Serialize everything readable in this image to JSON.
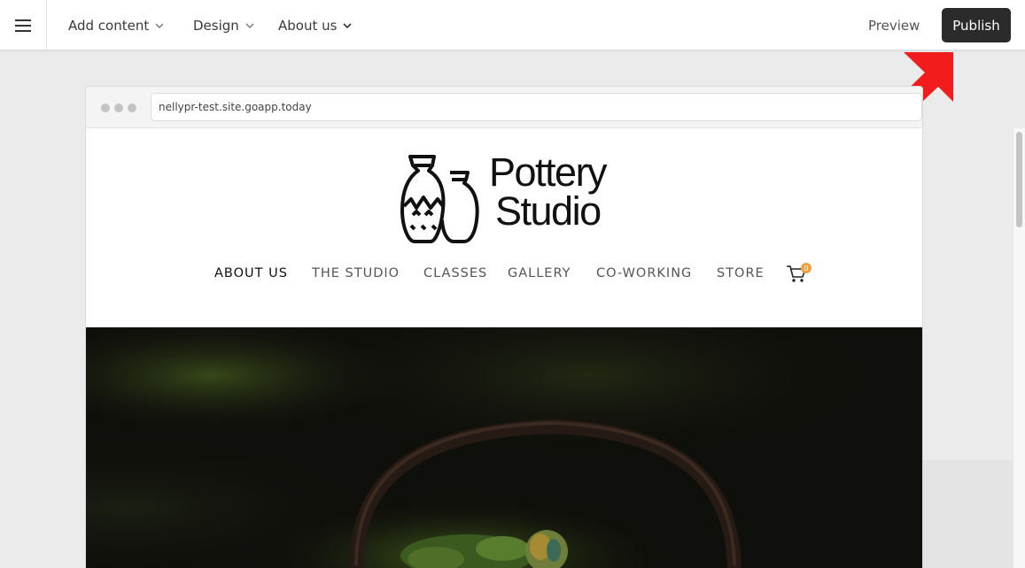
{
  "toolbar": {
    "menu_icon": "hamburger-menu-icon",
    "add_content": "Add content",
    "design": "Design",
    "about_us": "About us",
    "preview": "Preview",
    "publish": "Publish",
    "publish_bg": "#2b2b2b"
  },
  "annotation": {
    "arrow_color": "#f21c1c"
  },
  "browser": {
    "url": "nellypr-test.site.goapp.today"
  },
  "site": {
    "logo": {
      "line1": "Pottery",
      "line2": "Studio"
    },
    "nav": [
      "ABOUT US",
      "THE STUDIO",
      "CLASSES",
      "GALLERY",
      "CO-WORKING",
      "STORE"
    ],
    "active_nav": "ABOUT US",
    "cart_count": "0",
    "cart_badge_color": "#f0a042"
  }
}
